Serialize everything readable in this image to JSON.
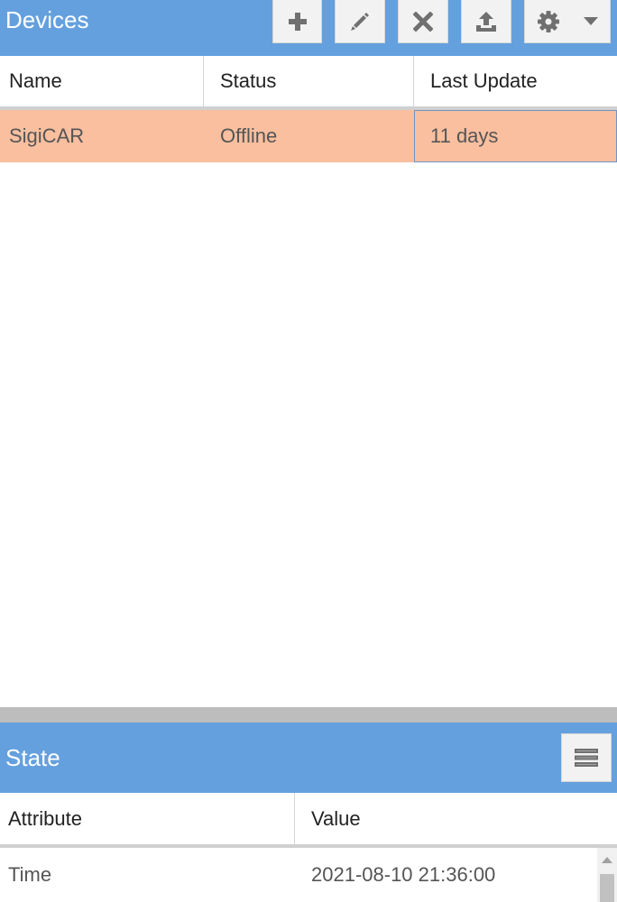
{
  "devices_panel": {
    "title": "Devices",
    "toolbar": {
      "add_icon": "plus-icon",
      "edit_icon": "pencil-icon",
      "remove_icon": "close-icon",
      "upload_icon": "upload-icon",
      "settings_icon": "gear-icon",
      "settings_menu_icon": "caret-down-icon"
    },
    "columns": [
      "Name",
      "Status",
      "Last Update"
    ],
    "rows": [
      {
        "name": "SigiCAR",
        "status": "Offline",
        "last_update": "11 days"
      }
    ],
    "colors": {
      "header_bg": "#64a0de",
      "selected_row_bg": "#f9bf9f"
    }
  },
  "state_panel": {
    "title": "State",
    "toolbar": {
      "menu_icon": "list-icon"
    },
    "columns": [
      "Attribute",
      "Value"
    ],
    "rows": [
      {
        "attribute": "Time",
        "value": "2021-08-10 21:36:00"
      }
    ]
  }
}
